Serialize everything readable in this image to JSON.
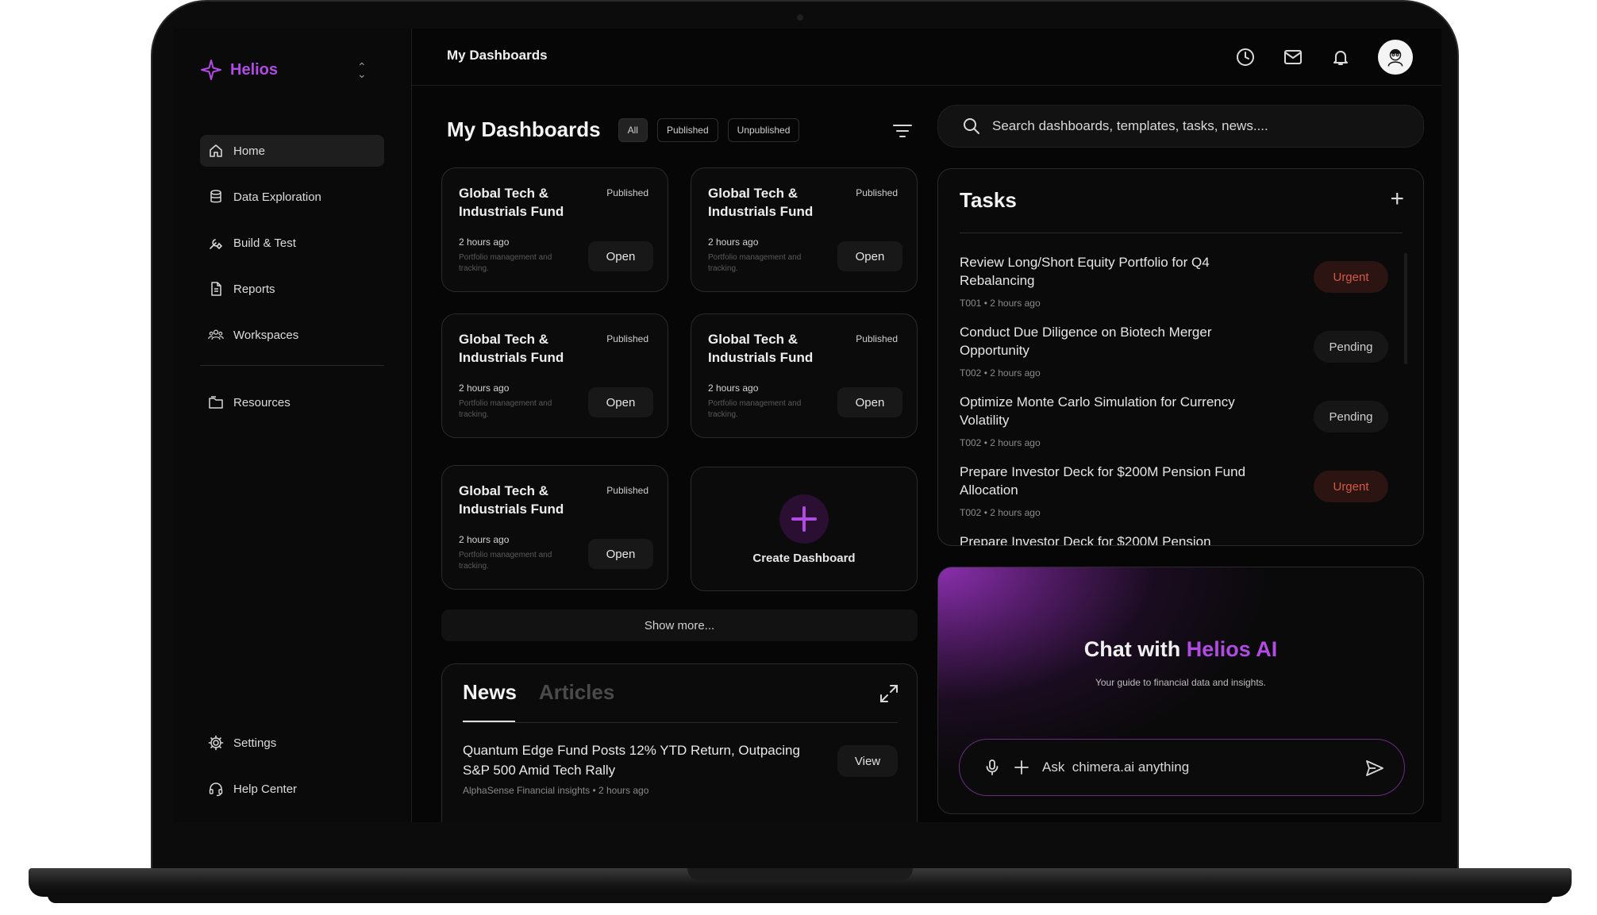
{
  "brand": {
    "name": "Helios",
    "accent_color": "#b04be3"
  },
  "sidebar": {
    "items": [
      {
        "label": "Home",
        "icon": "home-icon",
        "active": true
      },
      {
        "label": "Data Exploration",
        "icon": "database-icon"
      },
      {
        "label": "Build & Test",
        "icon": "wrench-icon"
      },
      {
        "label": "Reports",
        "icon": "document-icon"
      },
      {
        "label": "Workspaces",
        "icon": "users-icon"
      }
    ],
    "secondary": [
      {
        "label": "Resources",
        "icon": "folder-icon"
      }
    ],
    "bottom": [
      {
        "label": "Settings",
        "icon": "gear-icon"
      },
      {
        "label": "Help Center",
        "icon": "headset-icon"
      }
    ]
  },
  "topbar": {
    "title": "My Dashboards",
    "icons": [
      "clock-icon",
      "mail-icon",
      "bell-icon",
      "avatar"
    ]
  },
  "dashboards": {
    "title": "My Dashboards",
    "filters": [
      "All",
      "Published",
      "Unpublished"
    ],
    "active_filter": "All",
    "cards": [
      {
        "title": "Global Tech & Industrials Fund",
        "status": "Published",
        "time": "2 hours ago",
        "desc": "Portfolio management and tracking.",
        "action": "Open"
      },
      {
        "title": "Global Tech & Industrials Fund",
        "status": "Published",
        "time": "2 hours ago",
        "desc": "Portfolio management and tracking.",
        "action": "Open"
      },
      {
        "title": "Global Tech & Industrials Fund",
        "status": "Published",
        "time": "2 hours ago",
        "desc": "Portfolio management and tracking.",
        "action": "Open"
      },
      {
        "title": "Global Tech & Industrials Fund",
        "status": "Published",
        "time": "2 hours ago",
        "desc": "Portfolio management and tracking.",
        "action": "Open"
      },
      {
        "title": "Global Tech & Industrials Fund",
        "status": "Published",
        "time": "2 hours ago",
        "desc": "Portfolio management and tracking.",
        "action": "Open"
      }
    ],
    "create_label": "Create Dashboard",
    "show_more": "Show more..."
  },
  "news": {
    "tabs": [
      "News",
      "Articles"
    ],
    "active_tab": "News",
    "items": [
      {
        "headline": "Quantum Edge Fund Posts 12% YTD Return, Outpacing S&P 500 Amid Tech Rally",
        "source": "AlphaSense Financial insights",
        "time": "2 hours ago",
        "action": "View"
      }
    ]
  },
  "search": {
    "placeholder": "Search dashboards, templates, tasks, news...."
  },
  "tasks": {
    "title": "Tasks",
    "items": [
      {
        "title": "Review Long/Short Equity Portfolio for Q4 Rebalancing",
        "id": "T001",
        "time": "2 hours ago",
        "status": "Urgent"
      },
      {
        "title": "Conduct Due Diligence on Biotech Merger Opportunity",
        "id": "T002",
        "time": "2 hours ago",
        "status": "Pending"
      },
      {
        "title": "Optimize Monte Carlo Simulation for Currency Volatility",
        "id": "T002",
        "time": "2 hours ago",
        "status": "Pending"
      },
      {
        "title": "Prepare Investor Deck for $200M Pension Fund Allocation",
        "id": "T002",
        "time": "2 hours ago",
        "status": "Urgent"
      },
      {
        "title": "Prepare Investor Deck for $200M Pension",
        "id": "",
        "time": "",
        "status": ""
      }
    ],
    "colors": {
      "urgent": "#d35a43",
      "pending": "#cfcfcf"
    }
  },
  "chat": {
    "title_prefix": "Chat with",
    "title_accent": "Helios AI",
    "subtitle": "Your guide to financial data and insights.",
    "input_placeholder": "Ask  chimera.ai anything"
  }
}
